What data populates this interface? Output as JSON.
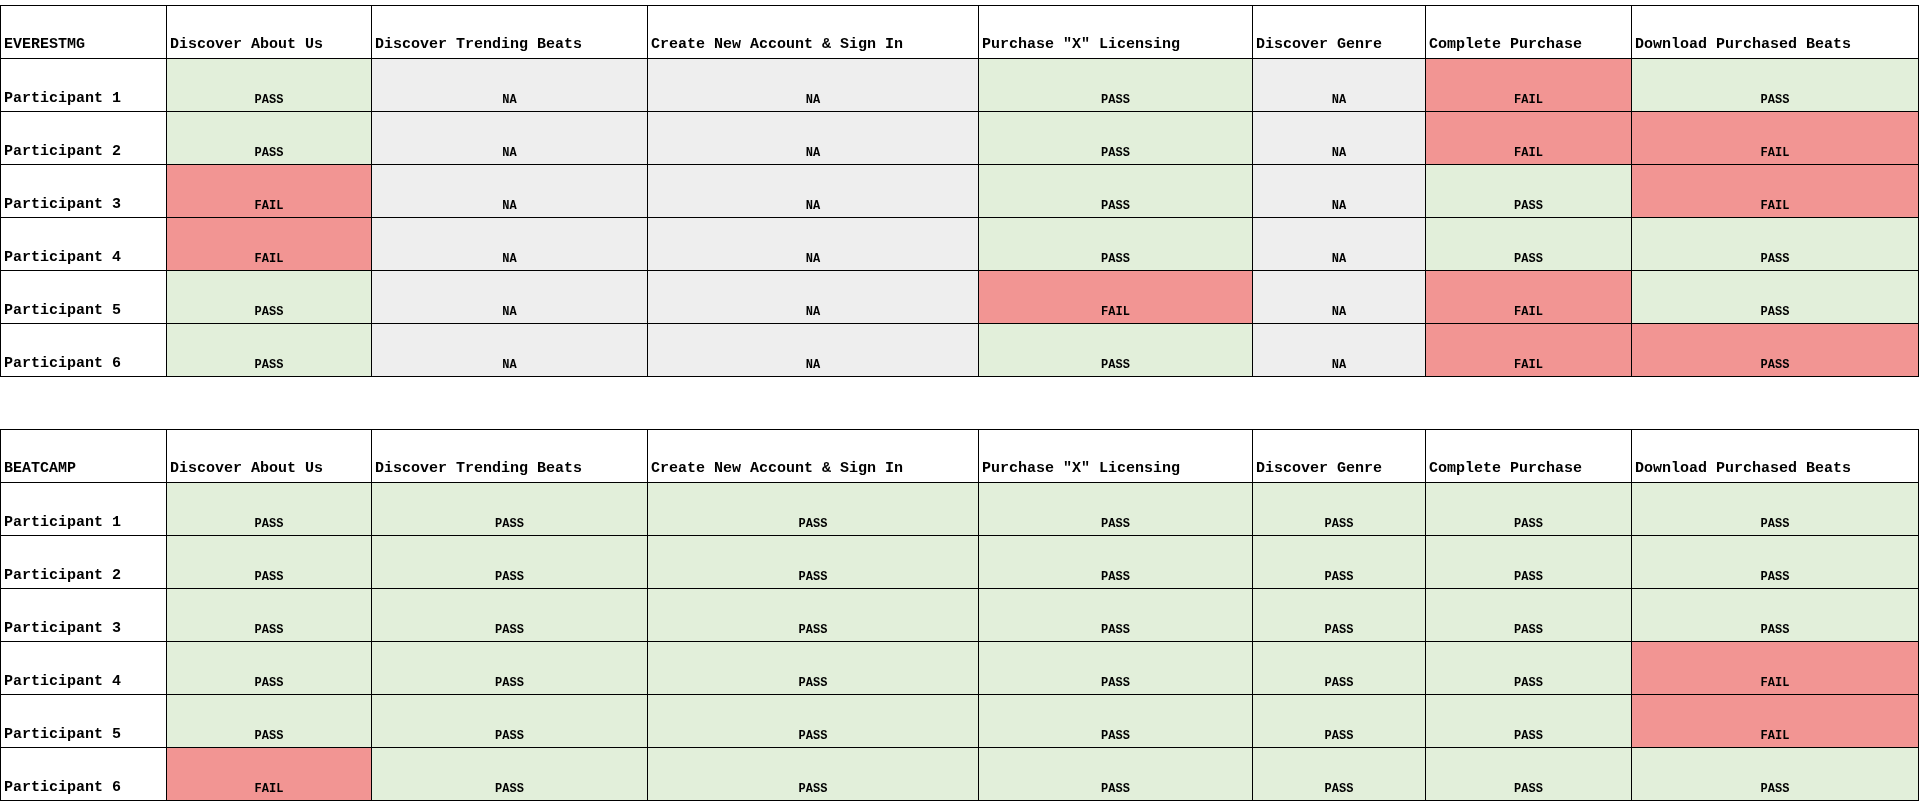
{
  "tables": [
    {
      "title": "EVERESTMG",
      "columns": [
        "Discover About Us",
        "Discover Trending Beats",
        "Create New Account & Sign In",
        "Purchase \"X\" Licensing",
        "Discover Genre",
        "Complete Purchase",
        "Download Purchased Beats"
      ],
      "rows": [
        {
          "label": "Participant 1",
          "cells": [
            {
              "text": "PASS",
              "color": "#e2efda"
            },
            {
              "text": "NA",
              "color": "#eeeeee"
            },
            {
              "text": "NA",
              "color": "#eeeeee"
            },
            {
              "text": "PASS",
              "color": "#e2efda"
            },
            {
              "text": "NA",
              "color": "#eeeeee"
            },
            {
              "text": "FAIL",
              "color": "#f29593"
            },
            {
              "text": "PASS",
              "color": "#e2efda"
            }
          ]
        },
        {
          "label": "Participant 2",
          "cells": [
            {
              "text": "PASS",
              "color": "#e2efda"
            },
            {
              "text": "NA",
              "color": "#eeeeee"
            },
            {
              "text": "NA",
              "color": "#eeeeee"
            },
            {
              "text": "PASS",
              "color": "#e2efda"
            },
            {
              "text": "NA",
              "color": "#eeeeee"
            },
            {
              "text": "FAIL",
              "color": "#f29593"
            },
            {
              "text": "FAIL",
              "color": "#f29593"
            }
          ]
        },
        {
          "label": "Participant 3",
          "cells": [
            {
              "text": "FAIL",
              "color": "#f29593"
            },
            {
              "text": "NA",
              "color": "#eeeeee"
            },
            {
              "text": "NA",
              "color": "#eeeeee"
            },
            {
              "text": "PASS",
              "color": "#e2efda"
            },
            {
              "text": "NA",
              "color": "#eeeeee"
            },
            {
              "text": "PASS",
              "color": "#e2efda"
            },
            {
              "text": "FAIL",
              "color": "#f29593"
            }
          ]
        },
        {
          "label": "Participant 4",
          "cells": [
            {
              "text": "FAIL",
              "color": "#f29593"
            },
            {
              "text": "NA",
              "color": "#eeeeee"
            },
            {
              "text": "NA",
              "color": "#eeeeee"
            },
            {
              "text": "PASS",
              "color": "#e2efda"
            },
            {
              "text": "NA",
              "color": "#eeeeee"
            },
            {
              "text": "PASS",
              "color": "#e2efda"
            },
            {
              "text": "PASS",
              "color": "#e2efda"
            }
          ]
        },
        {
          "label": "Participant 5",
          "cells": [
            {
              "text": "PASS",
              "color": "#e2efda"
            },
            {
              "text": "NA",
              "color": "#eeeeee"
            },
            {
              "text": "NA",
              "color": "#eeeeee"
            },
            {
              "text": "FAIL",
              "color": "#f29593"
            },
            {
              "text": "NA",
              "color": "#eeeeee"
            },
            {
              "text": "FAIL",
              "color": "#f29593"
            },
            {
              "text": "PASS",
              "color": "#e2efda"
            }
          ]
        },
        {
          "label": "Participant 6",
          "cells": [
            {
              "text": "PASS",
              "color": "#e2efda"
            },
            {
              "text": "NA",
              "color": "#eeeeee"
            },
            {
              "text": "NA",
              "color": "#eeeeee"
            },
            {
              "text": "PASS",
              "color": "#e2efda"
            },
            {
              "text": "NA",
              "color": "#eeeeee"
            },
            {
              "text": "FAIL",
              "color": "#f29593"
            },
            {
              "text": "PASS",
              "color": "#f29593"
            }
          ]
        }
      ]
    },
    {
      "title": "BEATCAMP",
      "columns": [
        "Discover About Us",
        "Discover Trending Beats",
        "Create New Account & Sign In",
        "Purchase \"X\" Licensing",
        "Discover Genre",
        "Complete Purchase",
        "Download Purchased Beats"
      ],
      "rows": [
        {
          "label": "Participant 1",
          "cells": [
            {
              "text": "PASS",
              "color": "#e2efda"
            },
            {
              "text": "PASS",
              "color": "#e2efda"
            },
            {
              "text": "PASS",
              "color": "#e2efda"
            },
            {
              "text": "PASS",
              "color": "#e2efda"
            },
            {
              "text": "PASS",
              "color": "#e2efda"
            },
            {
              "text": "PASS",
              "color": "#e2efda"
            },
            {
              "text": "PASS",
              "color": "#e2efda"
            }
          ]
        },
        {
          "label": "Participant 2",
          "cells": [
            {
              "text": "PASS",
              "color": "#e2efda"
            },
            {
              "text": "PASS",
              "color": "#e2efda"
            },
            {
              "text": "PASS",
              "color": "#e2efda"
            },
            {
              "text": "PASS",
              "color": "#e2efda"
            },
            {
              "text": "PASS",
              "color": "#e2efda"
            },
            {
              "text": "PASS",
              "color": "#e2efda"
            },
            {
              "text": "PASS",
              "color": "#e2efda"
            }
          ]
        },
        {
          "label": "Participant 3",
          "cells": [
            {
              "text": "PASS",
              "color": "#e2efda"
            },
            {
              "text": "PASS",
              "color": "#e2efda"
            },
            {
              "text": "PASS",
              "color": "#e2efda"
            },
            {
              "text": "PASS",
              "color": "#e2efda"
            },
            {
              "text": "PASS",
              "color": "#e2efda"
            },
            {
              "text": "PASS",
              "color": "#e2efda"
            },
            {
              "text": "PASS",
              "color": "#e2efda"
            }
          ]
        },
        {
          "label": "Participant 4",
          "cells": [
            {
              "text": "PASS",
              "color": "#e2efda"
            },
            {
              "text": "PASS",
              "color": "#e2efda"
            },
            {
              "text": "PASS",
              "color": "#e2efda"
            },
            {
              "text": "PASS",
              "color": "#e2efda"
            },
            {
              "text": "PASS",
              "color": "#e2efda"
            },
            {
              "text": "PASS",
              "color": "#e2efda"
            },
            {
              "text": "FAIL",
              "color": "#f29593"
            }
          ]
        },
        {
          "label": "Participant 5",
          "cells": [
            {
              "text": "PASS",
              "color": "#e2efda"
            },
            {
              "text": "PASS",
              "color": "#e2efda"
            },
            {
              "text": "PASS",
              "color": "#e2efda"
            },
            {
              "text": "PASS",
              "color": "#e2efda"
            },
            {
              "text": "PASS",
              "color": "#e2efda"
            },
            {
              "text": "PASS",
              "color": "#e2efda"
            },
            {
              "text": "FAIL",
              "color": "#f29593"
            }
          ]
        },
        {
          "label": "Participant 6",
          "cells": [
            {
              "text": "FAIL",
              "color": "#f29593"
            },
            {
              "text": "PASS",
              "color": "#e2efda"
            },
            {
              "text": "PASS",
              "color": "#e2efda"
            },
            {
              "text": "PASS",
              "color": "#e2efda"
            },
            {
              "text": "PASS",
              "color": "#e2efda"
            },
            {
              "text": "PASS",
              "color": "#e2efda"
            },
            {
              "text": "PASS",
              "color": "#e2efda"
            }
          ]
        }
      ]
    }
  ]
}
